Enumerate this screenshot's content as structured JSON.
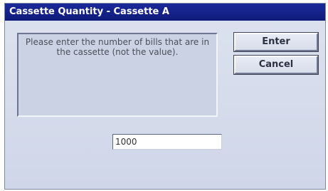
{
  "window": {
    "title": "Cassette Quantity - Cassette A"
  },
  "message": "Please enter the number of bills that are in the cassette (not the value).",
  "buttons": {
    "enter": "Enter",
    "cancel": "Cancel"
  },
  "quantity_input": {
    "value": "1000"
  },
  "colors": {
    "titlebar": "#1b2a9a",
    "background": "#d6dced"
  }
}
